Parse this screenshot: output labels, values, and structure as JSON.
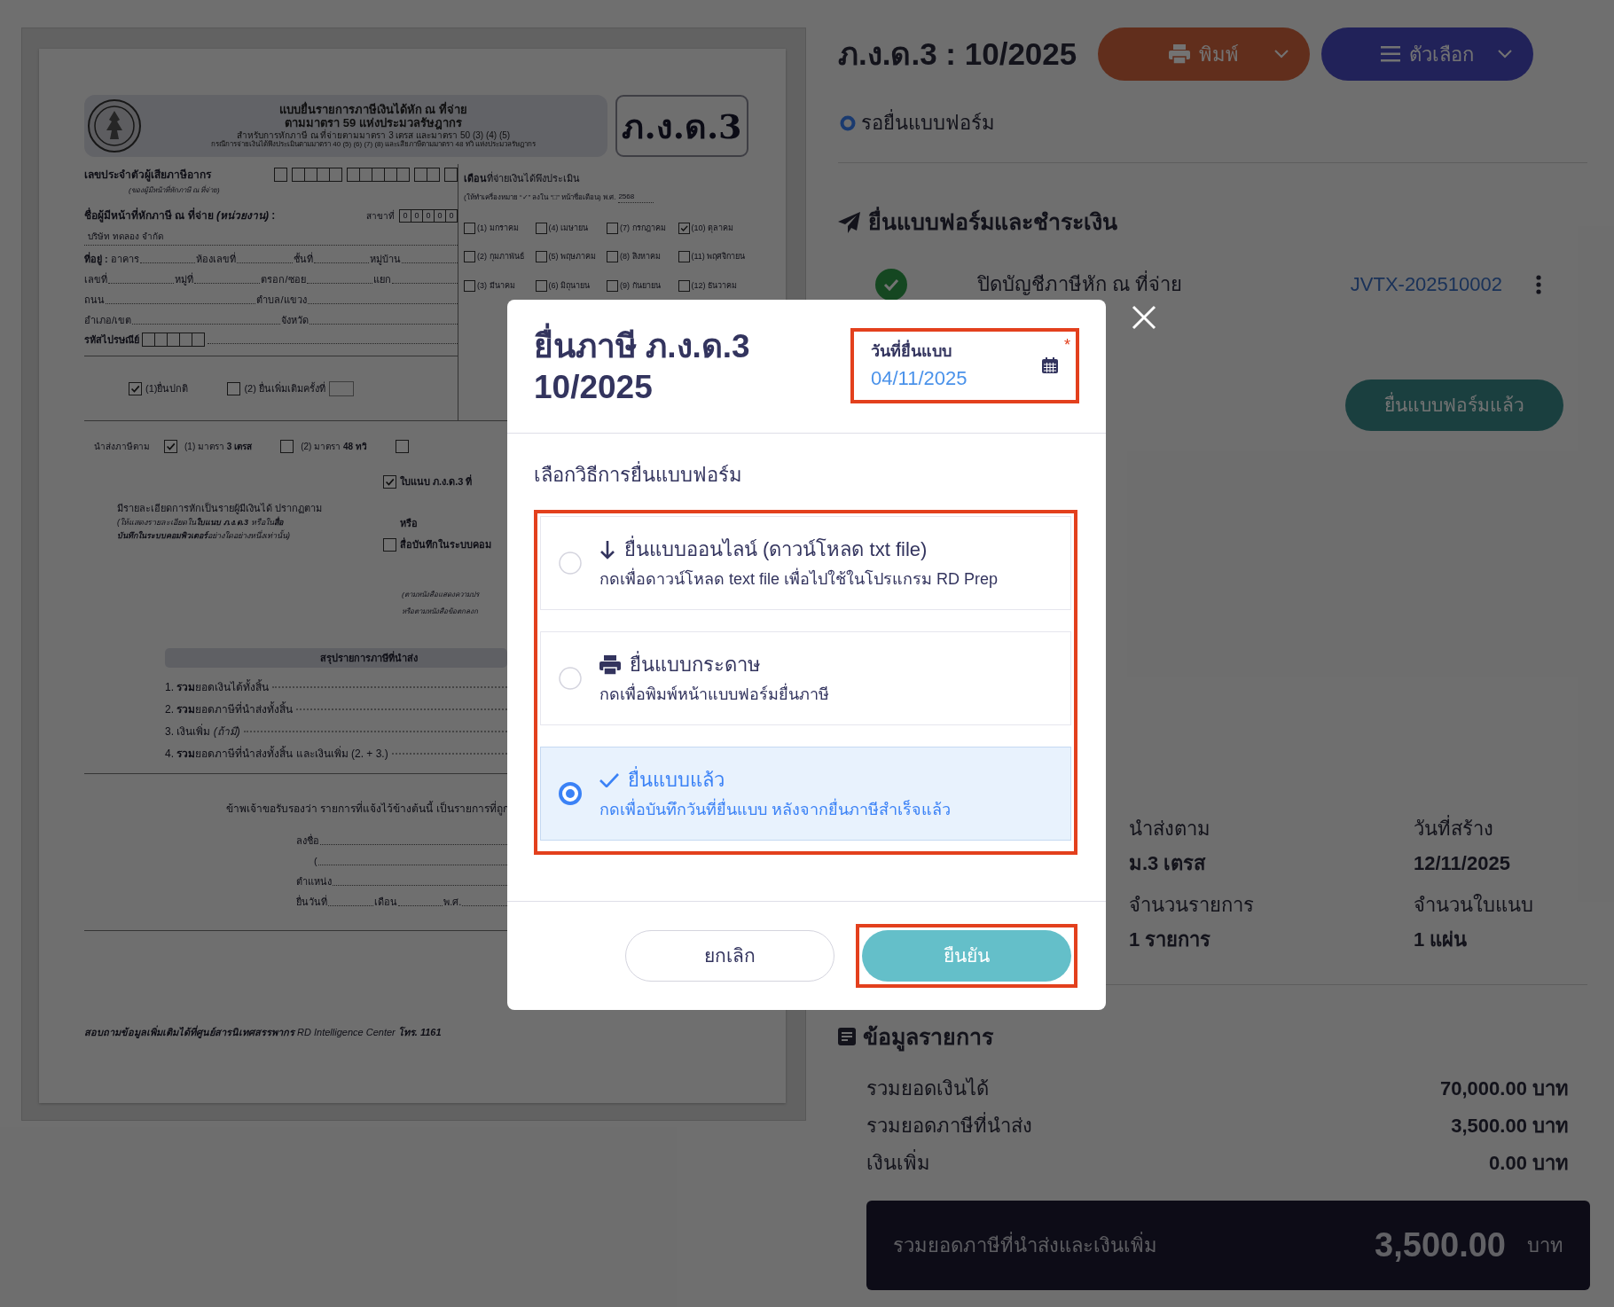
{
  "tax_form": {
    "header": {
      "title_lines": [
        "แบบยื่นรายการภาษีเงินได้หัก ณ ที่จ่าย",
        "ตามมาตรา 59 แห่งประมวลรัษฎากร",
        "สำหรับการหักภาษี ณ ที่จ่ายตามมาตรา 3 เตรส และมาตรา 50 (3) (4) (5)",
        "กรณีการจ่ายเงินได้พึงประเมินตามมาตรา 40 (5) (6) (7) (8) และเสียภาษีตามมาตรา 48 ทวิ แห่งประมวลรัษฎากร"
      ],
      "form_code": "ภ.ง.ด.3"
    },
    "taxpayer": {
      "id_label": "เลขประจำตัวผู้เสียภาษีอากร",
      "id_note": "(ของผู้มีหน้าที่หักภาษี ณ ที่จ่าย)",
      "name_label": "ชื่อผู้มีหน้าที่หักภาษี ณ ที่จ่าย *(หน่วยงาน)* :",
      "branch_label": "สาขาที่",
      "branch_digits": [
        "0",
        "0",
        "0",
        "0",
        "0"
      ],
      "company": "บริษัท ทดลอง จำกัด",
      "address_lines": [
        [
          "**ที่อยู่ :** อาคาร",
          "ห้องเลขที่",
          "ชั้นที่",
          "หมู่บ้าน"
        ],
        [
          "เลขที่",
          "หมู่ที่",
          "ตรอก/ซอย",
          "แยก"
        ],
        [
          "ถนน",
          "ตำบล/แขวง"
        ],
        [
          "อำเภอ/เขต",
          "จังหวัด"
        ]
      ],
      "postcode_label": "รหัสไปรษณีย์"
    },
    "months": {
      "title": "**เดือน**ที่จ่ายเงินได้พึงประเมิน",
      "note": "(ให้ทำเครื่องหมาย “✓” ลงใน “□” หน้าชื่อเดือน) พ.ศ.",
      "year": "2568",
      "items": [
        {
          "label": "(1) มกราคม",
          "checked": false
        },
        {
          "label": "(4) เมษายน",
          "checked": false
        },
        {
          "label": "(7) กรกฎาคม",
          "checked": false
        },
        {
          "label": "(10) ตุลาคม",
          "checked": true
        },
        {
          "label": "(2) กุมภาพันธ์",
          "checked": false
        },
        {
          "label": "(5) พฤษภาคม",
          "checked": false
        },
        {
          "label": "(8) สิงหาคม",
          "checked": false
        },
        {
          "label": "(11) พฤศจิกายน",
          "checked": false
        },
        {
          "label": "(3) มีนาคม",
          "checked": false
        },
        {
          "label": "(6) มิถุนายน",
          "checked": false
        },
        {
          "label": "(9) กันยายน",
          "checked": false
        },
        {
          "label": "(12) ธันวาคม",
          "checked": false
        }
      ]
    },
    "filing_types": [
      {
        "label": "(1)ยื่นปกติ",
        "checked": true
      },
      {
        "label": "(2) ยื่นเพิ่มเติมครั้งที่",
        "checked": false
      }
    ],
    "remit_label": "นำส่งภาษีตาม",
    "remit_options": [
      {
        "label": "(1) มาตรา **3 เตรส**",
        "checked": true
      },
      {
        "label": "(2) มาตรา **48 ทวิ**",
        "checked": false
      },
      {
        "checked": false
      }
    ],
    "attachment_text": "มีรายละเอียดการหักเป็นรายผู้มีเงินได้ ปรากฏตาม",
    "attachment_note": [
      "(ให้แสดงรายละเอียดใน**ใบแนบ ภ.ง.ด.3** หรือใน**สื่อ**",
      "**บันทึกในระบบคอมพิวเตอร์**อย่างใดอย่างหนึ่งเท่านั้น)"
    ],
    "attachment_options": [
      {
        "label": "ใบแนบ ภ.ง.ด.3 ที่",
        "checked": true
      },
      {
        "label": "สื่อบันทึกในระบบคอม",
        "checked": false
      }
    ],
    "or_label": "หรือ",
    "attachment_refs": [
      "(ตามหนังสือแสดงความปร",
      "หรือตามหนังสือข้อตกลงก"
    ],
    "summary": {
      "title": "สรุปรายการภาษีที่นำส่ง",
      "items": [
        "1. **รวม**ยอดเงินได้ทั้งสิ้น",
        "2. **รวม**ยอดภาษีที่นำส่งทั้งสิ้น",
        "3. เงินเพิ่ม *(ถ้ามี)*",
        "4. **รวม**ยอดภาษีที่นำส่งทั้งสิ้น และเงินเพิ่ม (2. + 3.)"
      ]
    },
    "declaration": "ข้าพเจ้าขอรับรองว่า รายการที่แจ้งไว้ข้างต้นนี้ เป็นรายการที่ถูก",
    "signature_lines": [
      [
        "ลงชื่อ"
      ],
      [
        "("
      ],
      [
        "ตำแหน่ง"
      ],
      [
        "ยื่นวันที่",
        "เดือน",
        "พ.ศ."
      ]
    ],
    "footer": "**สอบถามข้อมูลเพิ่มเติมได้ที่ศูนย์สารนิเทศสรรพากร** RD Intelligence Center **โทร. 1161**"
  },
  "page": {
    "title": "ภ.ง.ด.3 : 10/2025",
    "actions": [
      {
        "kind": "print",
        "label": "พิมพ์"
      },
      {
        "kind": "options",
        "label": "ตัวเลือก"
      }
    ],
    "status": "รอยื่นแบบฟอร์ม",
    "filing_section": {
      "title": "ยื่นแบบฟอร์มและชำระเงิน",
      "steps": [
        {
          "label": "ปิดบัญชีภาษีหัก ณ ที่จ่าย",
          "done": true,
          "reference": "JVTX-202510002"
        }
      ],
      "filed_button": "ยื่นแบบฟอร์มแล้ว"
    },
    "details": [
      {
        "label": "นำส่งตาม",
        "value": "ม.3 เตรส"
      },
      {
        "label": "วันที่สร้าง",
        "value": "12/11/2025"
      },
      {
        "label": "จำนวนรายการ",
        "value": "1 รายการ"
      },
      {
        "label": "จำนวนใบแนบ",
        "value": "1 แผ่น"
      }
    ],
    "items_section": {
      "title": "ข้อมูลรายการ",
      "rows": [
        {
          "label": "รวมยอดเงินได้",
          "value": "70,000.00 บาท"
        },
        {
          "label": "รวมยอดภาษีที่นำส่ง",
          "value": "3,500.00 บาท"
        },
        {
          "label": "เงินเพิ่ม",
          "value": "0.00 บาท"
        }
      ],
      "total": {
        "label": "รวมยอดภาษีที่นำส่งและเงินเพิ่ม",
        "amount": "3,500.00",
        "unit": "บาท"
      }
    }
  },
  "dialog": {
    "title_lines": [
      "ยื่นภาษี ภ.ง.ด.3",
      "10/2025"
    ],
    "date_field": {
      "label": "วันที่ยื่นแบบ",
      "value": "04/11/2025",
      "required": true,
      "required_mark": "*",
      "highlighted": true
    },
    "methods_label": "เลือกวิธีการยื่นแบบฟอร์ม",
    "methods_highlighted": true,
    "methods": [
      {
        "kind": "download",
        "title": "ยื่นแบบออนไลน์ (ดาวน์โหลด txt file)",
        "description": "กดเพื่อดาวน์โหลด text file เพื่อไปใช้ในโปรแกรม RD Prep",
        "selected": false
      },
      {
        "kind": "paper",
        "title": "ยื่นแบบกระดาษ",
        "description": "กดเพื่อพิมพ์หน้าแบบฟอร์มยื่นภาษี",
        "selected": false
      },
      {
        "kind": "filed",
        "title": "ยื่นแบบแล้ว",
        "description": "กดเพื่อบันทึกวันที่ยื่นแบบ หลังจากยื่นภาษีสำเร็จแล้ว",
        "selected": true
      }
    ],
    "buttons": [
      {
        "kind": "cancel",
        "label": "ยกเลิก",
        "highlighted": false
      },
      {
        "kind": "confirm",
        "label": "ยืนยัน",
        "highlighted": true
      }
    ]
  }
}
